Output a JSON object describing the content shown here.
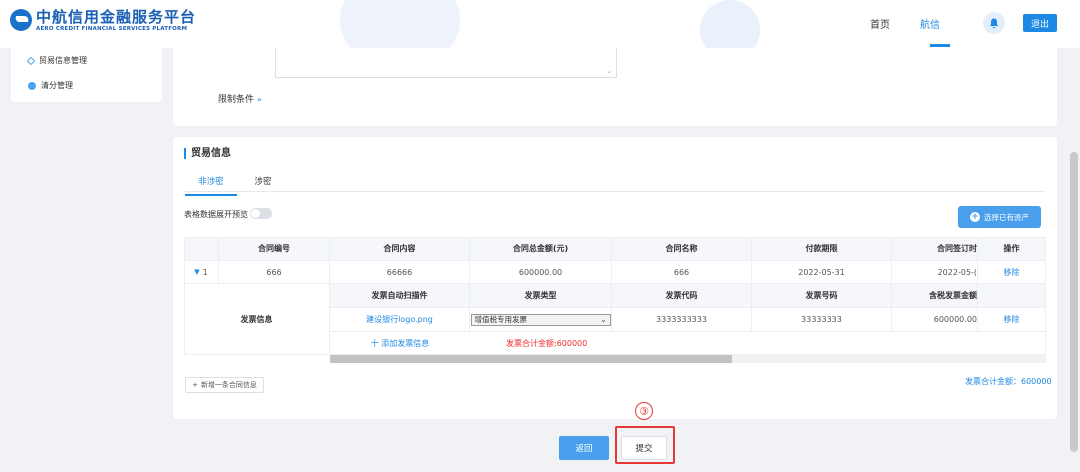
{
  "header": {
    "logo_cn": "中航信用金融服务平台",
    "logo_en": "AERO CREDIT FINANCIAL SERVICES PLATFORM",
    "nav": [
      {
        "label": "首页",
        "active": false
      },
      {
        "label": "航信",
        "active": true
      }
    ],
    "bell_icon": "bell-icon",
    "logout_label": "退出"
  },
  "sidebar": {
    "items": [
      {
        "label": "贸易信息管理",
        "icon": "layers-icon"
      },
      {
        "label": "清分管理",
        "icon": "circle-icon"
      }
    ]
  },
  "top_card": {
    "limit_label": "限制条件"
  },
  "trade": {
    "title": "贸易信息",
    "tabs": [
      {
        "label": "非涉密",
        "active": true
      },
      {
        "label": "涉密",
        "active": false
      }
    ],
    "preview_label": "表格数据展开预览",
    "select_asset_label": "选择已有资产",
    "table": {
      "headers": [
        "合同编号",
        "合同内容",
        "合同总金额(元)",
        "合同名称",
        "付款期限",
        "合同签订时",
        "操作"
      ],
      "row": {
        "index": "1",
        "values": [
          "666",
          "66666",
          "600000.00",
          "666",
          "2022-05-31",
          "2022-05-("
        ],
        "action": "移除"
      },
      "invoice": {
        "label": "发票信息",
        "headers": [
          "发票自动扫描件",
          "发票类型",
          "发票代码",
          "发票号码",
          "含税发票金额"
        ],
        "row": {
          "file": "建设银行logo.png",
          "type": "增值税专用发票",
          "code": "3333333333",
          "number": "33333333",
          "amount": "600000.00",
          "action": "移除"
        },
        "add_label": "十 添加发票信息",
        "sum_label": "发票合计金额:600000"
      }
    },
    "add_contract_label": "新增一条合同信息",
    "total_bottom": "发票合计金额：600000"
  },
  "footer": {
    "step_marker": "③",
    "back_label": "返回",
    "submit_label": "提交"
  }
}
